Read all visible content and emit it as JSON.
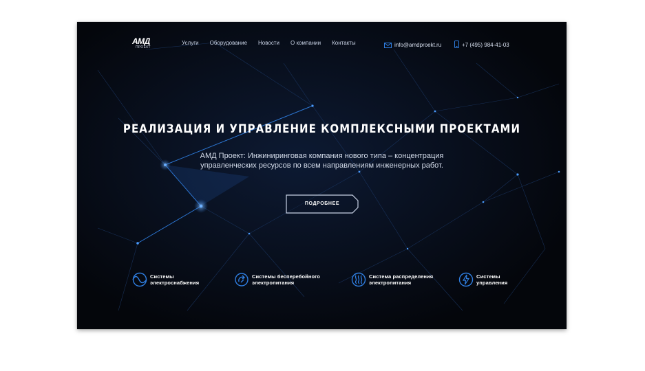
{
  "brand": {
    "logo_text": "АМД",
    "logo_sub": "ПРОЕКТ"
  },
  "nav": {
    "items": [
      "Услуги",
      "Оборудование",
      "Новости",
      "О компании",
      "Контакты"
    ]
  },
  "contacts": {
    "email": "info@amdproekt.ru",
    "phone": "+7 (495) 984-41-03"
  },
  "hero": {
    "title": "РЕАЛИЗАЦИЯ И УПРАВЛЕНИЕ КОМПЛЕКСНЫМИ ПРОЕКТАМИ",
    "subtitle_line1": "АМД Проект: Инжиниринговая компания нового типа – концентрация",
    "subtitle_line2": "управленческих ресурсов по всем направлениям инженерных работ.",
    "cta_label": "ПОДРОБНЕЕ"
  },
  "features": [
    {
      "line1": "Системы",
      "line2": "электроснабжения",
      "icon": "sine-wave-icon"
    },
    {
      "line1": "Системы бесперебойного",
      "line2": "электропитания",
      "icon": "power-cycle-icon"
    },
    {
      "line1": "Система распределения",
      "line2": "электропитания",
      "icon": "heat-waves-icon"
    },
    {
      "line1": "Системы",
      "line2": "управления",
      "icon": "lightning-icon"
    }
  ],
  "colors": {
    "accent": "#2f7ee0",
    "background": "#05070d",
    "text": "#ffffff"
  }
}
